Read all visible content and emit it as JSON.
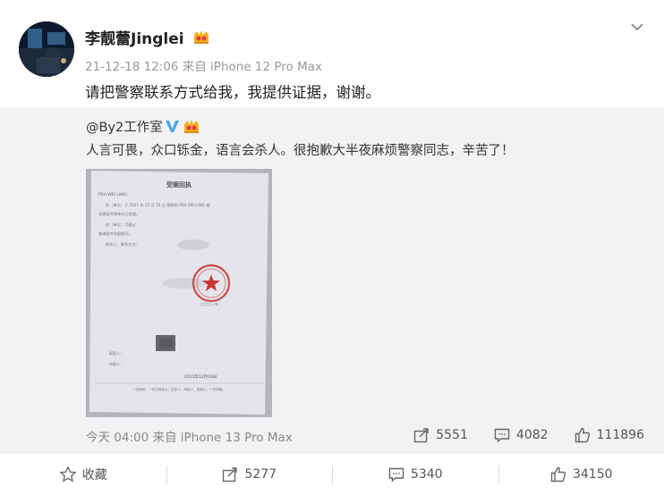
{
  "post": {
    "author_name": "李靓蕾Jinglei",
    "meta": "21-12-18 12:06 来自 iPhone 12 Pro Max",
    "text": "请把警察联系方式给我，我提供证据，谢谢。"
  },
  "repost": {
    "author": "@By2工作室",
    "text": "人言可畏，众口铄金，语言会杀人。很抱歉大半夜麻烦警察同志，辛苦了！",
    "meta": "今天 04:00 来自 iPhone 13 Pro Max",
    "reposts": "5551",
    "comments": "4082",
    "likes": "111896",
    "image": {
      "title": "受案回执",
      "name_line": "PEH WEI LING：",
      "field_line1": "你（单位）于 2021 年 12 月 16 日 报称的 PEH WEI LING 被",
      "field_line2": "诽谤案件我单位已受理。",
      "field_line3": "你（单位）可通过",
      "field_line4": "查询案件进展情况。",
      "contact_line": "联系人、联系方式：",
      "signer_line": "二〇二一年",
      "receiver_line1": "报案人：",
      "receiver_line2": "申报人：",
      "date_line": "2021年12月18日",
      "footnote": "一式两份，一份交报案人、控告人、申报人、投案人，一份附卷。"
    }
  },
  "footer": {
    "favorite": "收藏",
    "repost": "5277",
    "comment": "5340",
    "like": "34150"
  },
  "colors": {
    "vip_badge": "#f5b01e",
    "verify_blue": "#4aa7f0",
    "stamp_red": "#c73434"
  }
}
